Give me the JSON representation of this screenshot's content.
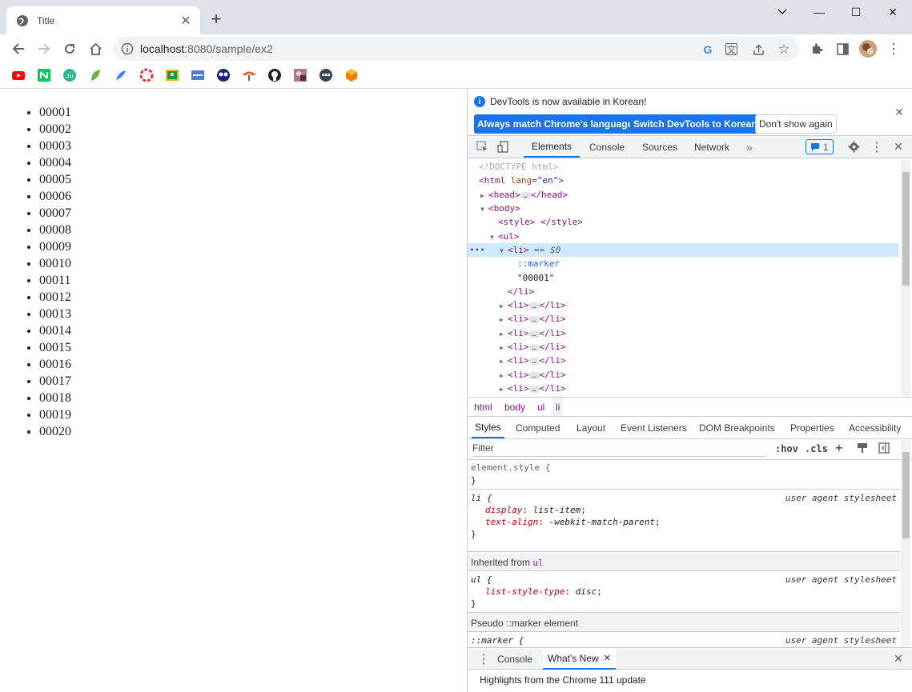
{
  "tab": {
    "title": "Title",
    "close": "✕"
  },
  "newtab": "+",
  "window": {
    "minimize": "—",
    "maximize": "☐",
    "close": "✕"
  },
  "address": {
    "host": "localhost",
    "path": ":8080/sample/ex2"
  },
  "page": {
    "items": [
      "00001",
      "00002",
      "00003",
      "00004",
      "00005",
      "00006",
      "00007",
      "00008",
      "00009",
      "00010",
      "00011",
      "00012",
      "00013",
      "00014",
      "00015",
      "00016",
      "00017",
      "00018",
      "00019",
      "00020"
    ]
  },
  "devtools": {
    "banner": {
      "message": "DevTools is now available in Korean!",
      "btn_match": "Always match Chrome's language",
      "btn_switch": "Switch DevTools to Korean",
      "btn_dont": "Don't show again"
    },
    "tabs": [
      "Elements",
      "Console",
      "Sources",
      "Network"
    ],
    "issues_count": "1",
    "crumbs": [
      "html",
      "body",
      "ul",
      "li"
    ],
    "styles_tabs": [
      "Styles",
      "Computed",
      "Layout",
      "Event Listeners",
      "DOM Breakpoints",
      "Properties",
      "Accessibility"
    ],
    "filter": {
      "placeholder": "Filter",
      "hov": ":hov",
      "cls": ".cls"
    },
    "inherited_label": "Inherited from",
    "inherited_from": "ul",
    "pseudo_label": "Pseudo ::marker element",
    "source": "user agent stylesheet",
    "drawer": {
      "console": "Console",
      "whatsnew": "What's New",
      "highlights": "Highlights from the Chrome 111 update"
    }
  }
}
